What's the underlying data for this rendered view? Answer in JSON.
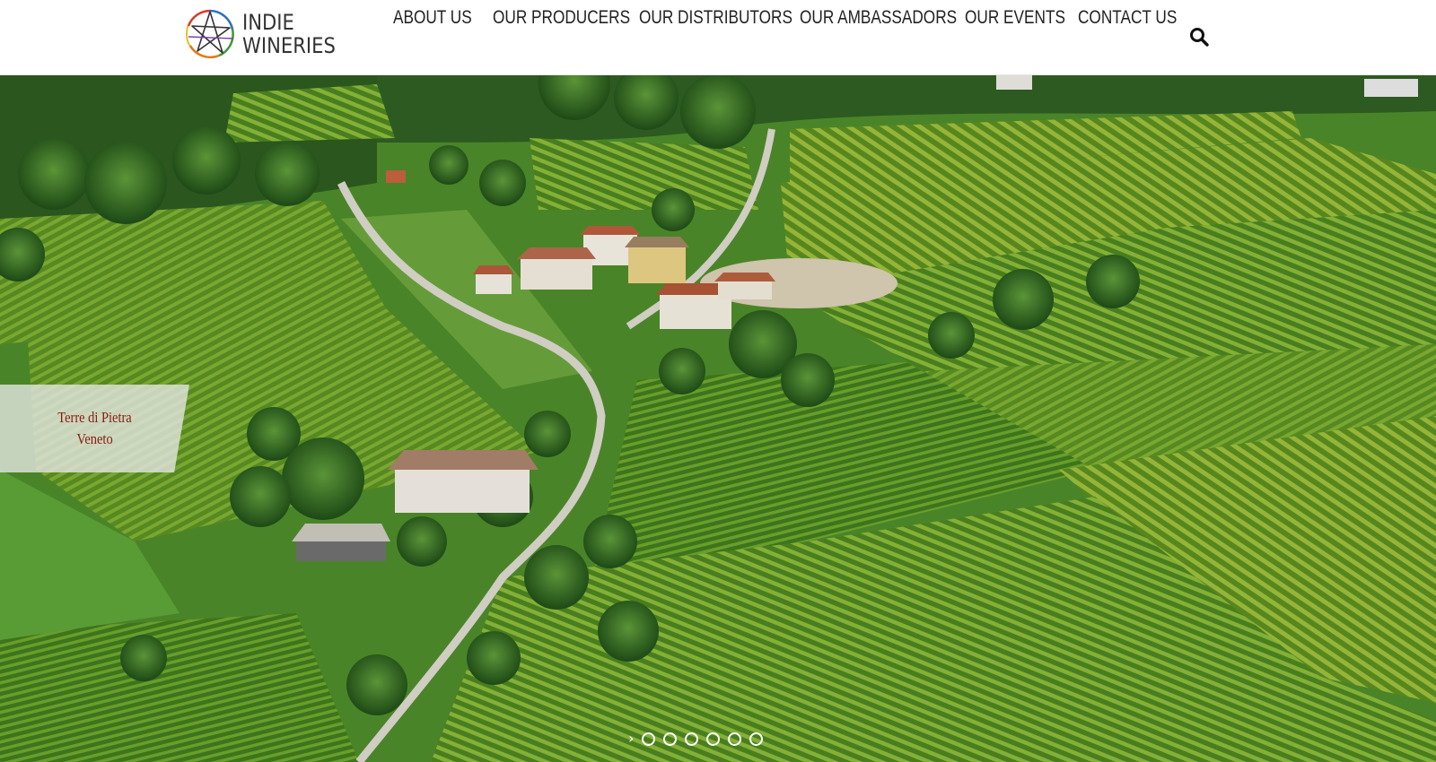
{
  "header": {
    "logo": {
      "line1": "INDIE",
      "line2": "WINERIES"
    },
    "nav": [
      {
        "label": "ABOUT US"
      },
      {
        "label": "OUR PRODUCERS"
      },
      {
        "label": "OUR DISTRIBUTORS"
      },
      {
        "label": "OUR AMBASSADORS"
      },
      {
        "label": "OUR EVENTS"
      },
      {
        "label": "CONTACT US"
      }
    ],
    "search_icon": "search-icon"
  },
  "hero": {
    "image_alt_icon": "vineyard-aerial-photo",
    "caption": {
      "name": "Terre di Pietra",
      "region": "Veneto"
    },
    "carousel": {
      "arrow_icon": "chevron-right-icon",
      "dot_count": 6
    }
  },
  "colors": {
    "caption_text": "#8b1a12",
    "nav_text": "#222222",
    "vine_green": "#4f8a2a"
  }
}
